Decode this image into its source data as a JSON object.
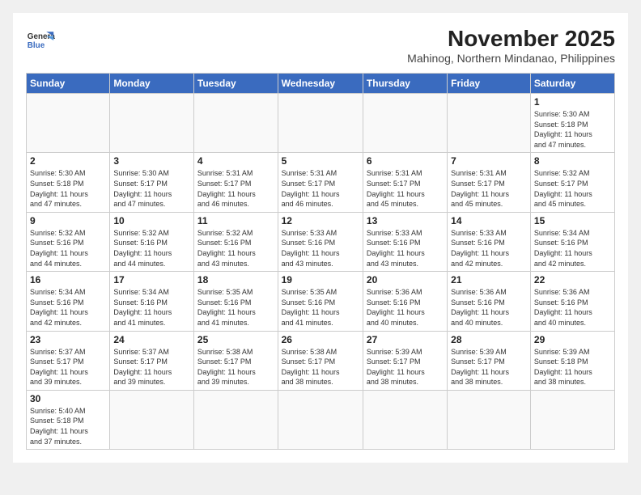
{
  "logo": {
    "line1": "General",
    "line2": "Blue"
  },
  "title": "November 2025",
  "location": "Mahinog, Northern Mindanao, Philippines",
  "days_of_week": [
    "Sunday",
    "Monday",
    "Tuesday",
    "Wednesday",
    "Thursday",
    "Friday",
    "Saturday"
  ],
  "weeks": [
    [
      {
        "day": "",
        "info": ""
      },
      {
        "day": "",
        "info": ""
      },
      {
        "day": "",
        "info": ""
      },
      {
        "day": "",
        "info": ""
      },
      {
        "day": "",
        "info": ""
      },
      {
        "day": "",
        "info": ""
      },
      {
        "day": "1",
        "info": "Sunrise: 5:30 AM\nSunset: 5:18 PM\nDaylight: 11 hours\nand 47 minutes."
      }
    ],
    [
      {
        "day": "2",
        "info": "Sunrise: 5:30 AM\nSunset: 5:18 PM\nDaylight: 11 hours\nand 47 minutes."
      },
      {
        "day": "3",
        "info": "Sunrise: 5:30 AM\nSunset: 5:17 PM\nDaylight: 11 hours\nand 47 minutes."
      },
      {
        "day": "4",
        "info": "Sunrise: 5:31 AM\nSunset: 5:17 PM\nDaylight: 11 hours\nand 46 minutes."
      },
      {
        "day": "5",
        "info": "Sunrise: 5:31 AM\nSunset: 5:17 PM\nDaylight: 11 hours\nand 46 minutes."
      },
      {
        "day": "6",
        "info": "Sunrise: 5:31 AM\nSunset: 5:17 PM\nDaylight: 11 hours\nand 45 minutes."
      },
      {
        "day": "7",
        "info": "Sunrise: 5:31 AM\nSunset: 5:17 PM\nDaylight: 11 hours\nand 45 minutes."
      },
      {
        "day": "8",
        "info": "Sunrise: 5:32 AM\nSunset: 5:17 PM\nDaylight: 11 hours\nand 45 minutes."
      }
    ],
    [
      {
        "day": "9",
        "info": "Sunrise: 5:32 AM\nSunset: 5:16 PM\nDaylight: 11 hours\nand 44 minutes."
      },
      {
        "day": "10",
        "info": "Sunrise: 5:32 AM\nSunset: 5:16 PM\nDaylight: 11 hours\nand 44 minutes."
      },
      {
        "day": "11",
        "info": "Sunrise: 5:32 AM\nSunset: 5:16 PM\nDaylight: 11 hours\nand 43 minutes."
      },
      {
        "day": "12",
        "info": "Sunrise: 5:33 AM\nSunset: 5:16 PM\nDaylight: 11 hours\nand 43 minutes."
      },
      {
        "day": "13",
        "info": "Sunrise: 5:33 AM\nSunset: 5:16 PM\nDaylight: 11 hours\nand 43 minutes."
      },
      {
        "day": "14",
        "info": "Sunrise: 5:33 AM\nSunset: 5:16 PM\nDaylight: 11 hours\nand 42 minutes."
      },
      {
        "day": "15",
        "info": "Sunrise: 5:34 AM\nSunset: 5:16 PM\nDaylight: 11 hours\nand 42 minutes."
      }
    ],
    [
      {
        "day": "16",
        "info": "Sunrise: 5:34 AM\nSunset: 5:16 PM\nDaylight: 11 hours\nand 42 minutes."
      },
      {
        "day": "17",
        "info": "Sunrise: 5:34 AM\nSunset: 5:16 PM\nDaylight: 11 hours\nand 41 minutes."
      },
      {
        "day": "18",
        "info": "Sunrise: 5:35 AM\nSunset: 5:16 PM\nDaylight: 11 hours\nand 41 minutes."
      },
      {
        "day": "19",
        "info": "Sunrise: 5:35 AM\nSunset: 5:16 PM\nDaylight: 11 hours\nand 41 minutes."
      },
      {
        "day": "20",
        "info": "Sunrise: 5:36 AM\nSunset: 5:16 PM\nDaylight: 11 hours\nand 40 minutes."
      },
      {
        "day": "21",
        "info": "Sunrise: 5:36 AM\nSunset: 5:16 PM\nDaylight: 11 hours\nand 40 minutes."
      },
      {
        "day": "22",
        "info": "Sunrise: 5:36 AM\nSunset: 5:16 PM\nDaylight: 11 hours\nand 40 minutes."
      }
    ],
    [
      {
        "day": "23",
        "info": "Sunrise: 5:37 AM\nSunset: 5:17 PM\nDaylight: 11 hours\nand 39 minutes."
      },
      {
        "day": "24",
        "info": "Sunrise: 5:37 AM\nSunset: 5:17 PM\nDaylight: 11 hours\nand 39 minutes."
      },
      {
        "day": "25",
        "info": "Sunrise: 5:38 AM\nSunset: 5:17 PM\nDaylight: 11 hours\nand 39 minutes."
      },
      {
        "day": "26",
        "info": "Sunrise: 5:38 AM\nSunset: 5:17 PM\nDaylight: 11 hours\nand 38 minutes."
      },
      {
        "day": "27",
        "info": "Sunrise: 5:39 AM\nSunset: 5:17 PM\nDaylight: 11 hours\nand 38 minutes."
      },
      {
        "day": "28",
        "info": "Sunrise: 5:39 AM\nSunset: 5:17 PM\nDaylight: 11 hours\nand 38 minutes."
      },
      {
        "day": "29",
        "info": "Sunrise: 5:39 AM\nSunset: 5:18 PM\nDaylight: 11 hours\nand 38 minutes."
      }
    ],
    [
      {
        "day": "30",
        "info": "Sunrise: 5:40 AM\nSunset: 5:18 PM\nDaylight: 11 hours\nand 37 minutes."
      },
      {
        "day": "",
        "info": ""
      },
      {
        "day": "",
        "info": ""
      },
      {
        "day": "",
        "info": ""
      },
      {
        "day": "",
        "info": ""
      },
      {
        "day": "",
        "info": ""
      },
      {
        "day": "",
        "info": ""
      }
    ]
  ]
}
